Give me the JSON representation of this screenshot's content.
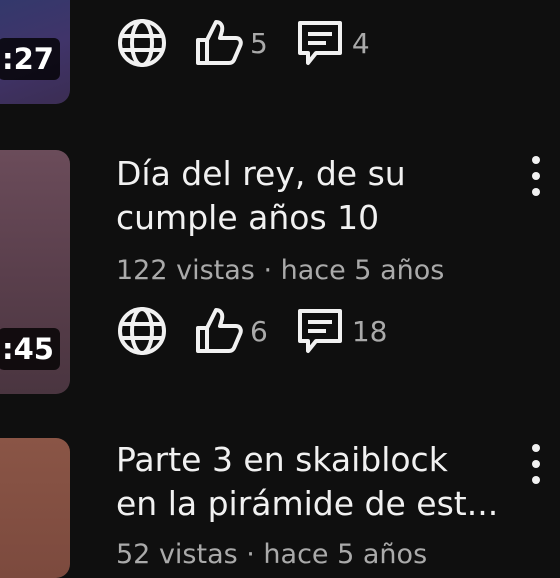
{
  "items": [
    {
      "duration": ":27",
      "likes": "5",
      "comments": "4"
    },
    {
      "title_line1": "Día del rey, de su",
      "title_line2": "cumple años 10",
      "meta": "122 vistas · hace 5 años",
      "duration": ":45",
      "likes": "6",
      "comments": "18"
    },
    {
      "title_line1": "Parte 3 en skaiblock",
      "title_line2": "en la pirámide de est...",
      "meta": "52 vistas · hace 5 años"
    }
  ],
  "icons": {
    "visibility": "globe-icon",
    "like": "thumbs-up-icon",
    "comment": "comment-icon",
    "menu": "more-vert-icon"
  }
}
